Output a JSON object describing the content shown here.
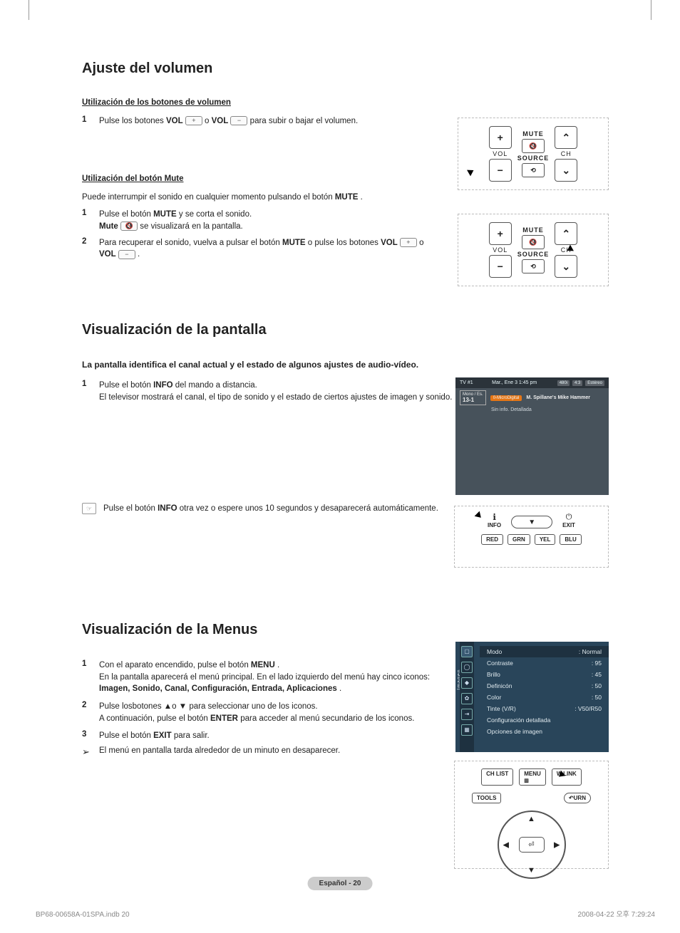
{
  "section1": {
    "title": "Ajuste del volumen",
    "sub1": "Utilización de los botones de volumen",
    "step1_num": "1",
    "step1_a": "Pulse los botones ",
    "vol": "VOL",
    "plus": "+",
    "or": " o ",
    "minus": "−",
    "step1_b": " para subir o bajar el volumen.",
    "sub2": "Utilización del botón Mute",
    "intro2": "Puede interrumpir el sonido en cualquier momento pulsando el botón ",
    "mute": "MUTE",
    "period": ".",
    "m_step1_num": "1",
    "m_step1_a": "Pulse el botón ",
    "m_step1_b": " y se corta el sonido.",
    "m_step1_line2_a": "Mute",
    "m_step1_line2_icon": "🔇",
    "m_step1_line2_b": " se visualizará en la pantalla.",
    "m_step2_num": "2",
    "m_step2_a": "Para recuperar el sonido, vuelva a pulsar el botón ",
    "m_step2_b": " o pulse los botones ",
    "m_step2_c": "."
  },
  "section2": {
    "title": "Visualización de la pantalla",
    "intro": "La pantalla identifica el canal actual y el estado de algunos ajustes de audio-vídeo.",
    "step1_num": "1",
    "step1_a": "Pulse el botón ",
    "info": "INFO",
    "step1_b": " del mando a distancia.",
    "step1_line2": "El televisor mostrará el canal, el tipo de sonido y el estado de ciertos ajustes de imagen y sonido.",
    "tip_a": "Pulse el botón ",
    "tip_b": " otra vez o espere unos 10 segundos y desaparecerá automáticamente."
  },
  "section3": {
    "title": "Visualización de la Menus",
    "s1_num": "1",
    "s1_a": "Con el aparato encendido, pulse el botón ",
    "menu": "MENU",
    "s1_b": ".",
    "s1_line2": "En la pantalla aparecerá el menú principal. En el lado izquierdo del menú hay cinco iconos: ",
    "icons": "Imagen, Sonido, Canal, Configuración, Entrada, Aplicaciones",
    "s1_line2_end": ".",
    "s2_num": "2",
    "s2_a": "Pulse losbotones ▲o ▼ para seleccionar uno de los iconos.",
    "s2_b": "A continuación, pulse el botón ",
    "enter": "ENTER",
    "s2_c": " para acceder al menú secundario de los iconos.",
    "s3_num": "3",
    "s3_a": "Pulse el botón ",
    "exit": "EXIT",
    "s3_b": " para salir.",
    "note": "El menú en pantalla tarda alrededor de un minuto en desaparecer."
  },
  "remote": {
    "vol": "VOL",
    "mute": "MUTE",
    "source": "SOURCE",
    "ch": "CH",
    "plus": "+",
    "minus": "−",
    "up": "⌃",
    "down": "⌄",
    "mute_icon": "🔇",
    "source_icon": "⟲"
  },
  "tvshot": {
    "left": "TV #1",
    "time": "Mar., Ene 3 1:45 pm",
    "right_badges": [
      "480i",
      "4:3",
      "Estéreo"
    ],
    "ch": "13-1",
    "ch_top": "Mono / Es.",
    "tag": "0-MicroDigital",
    "prog": "M. Spillane's Mike Hammer",
    "sub": "Sin info. Detallada"
  },
  "infobtns": {
    "info": "INFO",
    "exit": "EXIT",
    "red": "RED",
    "grn": "GRN",
    "yel": "YEL",
    "blu": "BLU"
  },
  "menuosd": {
    "side_label": "Imagen",
    "rows": [
      {
        "k": "Modo",
        "v": ": Normal"
      },
      {
        "k": "Contraste",
        "v": ": 95"
      },
      {
        "k": "Brillo",
        "v": ": 45"
      },
      {
        "k": "Definicón",
        "v": ": 50"
      },
      {
        "k": "Color",
        "v": ": 50"
      },
      {
        "k": "Tinte (V/R)",
        "v": ": V50/R50"
      },
      {
        "k": "Configuración detallada",
        "v": ""
      },
      {
        "k": "Opciones de imagen",
        "v": ""
      }
    ]
  },
  "menuremote": {
    "chlist": "CH LIST",
    "menu": "MENU",
    "wlink": "W.LINK",
    "tools": "TOOLS",
    "return": "URN",
    "enter": "⏎"
  },
  "footer": {
    "badge": "Español - 20",
    "left": "BP68-00658A-01SPA.indb   20",
    "right": "2008-04-22   오후 7:29:24"
  }
}
